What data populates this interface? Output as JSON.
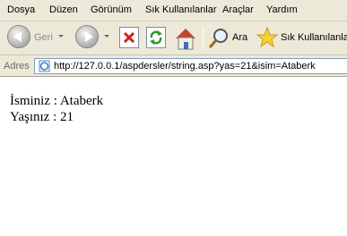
{
  "menu": [
    "Dosya",
    "Düzen",
    "Görünüm",
    "Sık Kullanılanlar",
    "Araçlar",
    "Yardım"
  ],
  "toolbar": {
    "back_label": "Geri",
    "search_label": "Ara",
    "favorites_label": "Sık Kullanılanlar"
  },
  "address": {
    "label": "Adres",
    "url": "http://127.0.0.1/aspdersler/string.asp?yas=21&isim=Ataberk"
  },
  "content": {
    "lines": [
      "İsminiz : Ataberk",
      "Yaşınız : 21"
    ]
  }
}
